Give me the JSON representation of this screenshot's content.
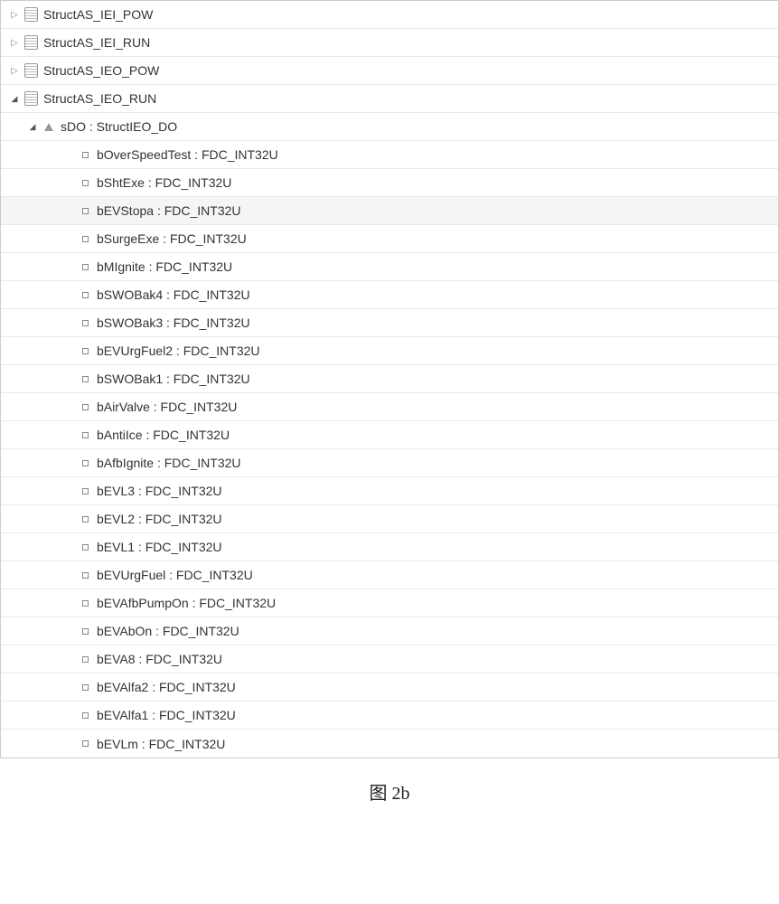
{
  "tree": {
    "roots": [
      {
        "label": "StructAS_IEI_POW",
        "expanded": false
      },
      {
        "label": "StructAS_IEI_RUN",
        "expanded": false
      },
      {
        "label": "StructAS_IEO_POW",
        "expanded": false
      },
      {
        "label": "StructAS_IEO_RUN",
        "expanded": true
      }
    ],
    "child": {
      "label": "sDO : StructIEO_DO",
      "expanded": true
    },
    "members": [
      {
        "label": "bOverSpeedTest : FDC_INT32U"
      },
      {
        "label": "bShtExe : FDC_INT32U"
      },
      {
        "label": "bEVStopa : FDC_INT32U",
        "highlighted": true
      },
      {
        "label": "bSurgeExe : FDC_INT32U"
      },
      {
        "label": "bMIgnite : FDC_INT32U"
      },
      {
        "label": "bSWOBak4 : FDC_INT32U"
      },
      {
        "label": "bSWOBak3 : FDC_INT32U"
      },
      {
        "label": "bEVUrgFuel2 : FDC_INT32U"
      },
      {
        "label": "bSWOBak1 : FDC_INT32U"
      },
      {
        "label": "bAirValve : FDC_INT32U"
      },
      {
        "label": "bAntiIce : FDC_INT32U"
      },
      {
        "label": "bAfbIgnite : FDC_INT32U"
      },
      {
        "label": "bEVL3 : FDC_INT32U"
      },
      {
        "label": "bEVL2 : FDC_INT32U"
      },
      {
        "label": "bEVL1 : FDC_INT32U"
      },
      {
        "label": "bEVUrgFuel : FDC_INT32U"
      },
      {
        "label": "bEVAfbPumpOn : FDC_INT32U"
      },
      {
        "label": "bEVAbOn : FDC_INT32U"
      },
      {
        "label": "bEVA8 : FDC_INT32U"
      },
      {
        "label": "bEVAlfa2 : FDC_INT32U"
      },
      {
        "label": "bEVAlfa1 : FDC_INT32U"
      },
      {
        "label": "bEVLm : FDC_INT32U"
      }
    ]
  },
  "caption": "图 2b"
}
